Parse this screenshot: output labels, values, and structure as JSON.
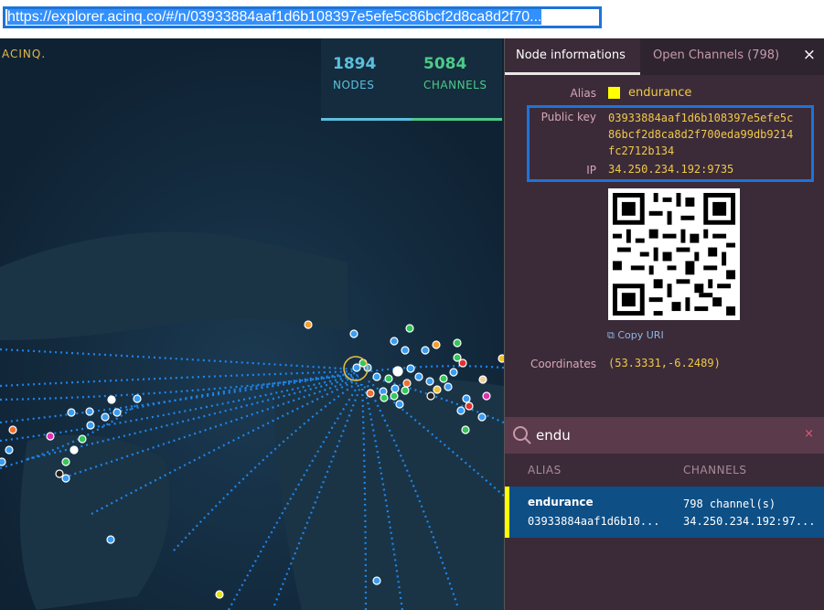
{
  "browser": {
    "url": "https://explorer.acinq.co/#/n/03933884aaf1d6b108397e5efe5c86bcf2d8ca8d2f70..."
  },
  "map": {
    "brand": "ACINQ.",
    "stats": [
      {
        "value": "1894",
        "label": "NODES"
      },
      {
        "value": "5084",
        "label": "CHANNELS"
      }
    ]
  },
  "panel": {
    "tabs": [
      {
        "label": "Node informations",
        "active": true
      },
      {
        "label": "Open Channels (798)",
        "active": false
      }
    ],
    "close_icon": "×",
    "node": {
      "alias_label": "Alias",
      "alias": "endurance",
      "alias_color": "#ffff00",
      "pubkey_label": "Public key",
      "pubkey_lines": [
        "03933884aaf1d6b108397e5efe5c",
        "86bcf2d8ca8d2f700eda99db9214",
        "fc2712b134"
      ],
      "ip_label": "IP",
      "ip": "34.250.234.192:9735",
      "copy_label": "Copy URI",
      "coords_label": "Coordinates",
      "coords": "(53.3331,-6.2489)"
    },
    "search": {
      "query": "endu",
      "clear_icon": "×"
    },
    "results": {
      "columns": [
        "ALIAS",
        "CHANNELS"
      ],
      "rows": [
        {
          "alias": "endurance",
          "pubkey": "03933884aaf1d6b10...",
          "channels": "798 channel(s)",
          "ip": "34.250.234.192:97..."
        }
      ]
    }
  }
}
